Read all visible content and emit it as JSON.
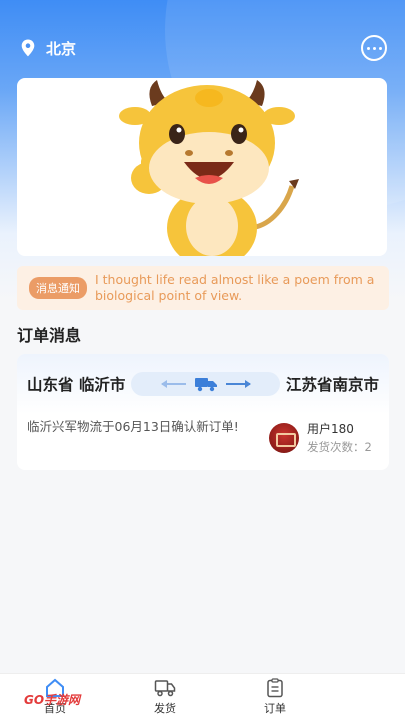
{
  "header": {
    "city": "北京",
    "location_icon": "location-pin-icon",
    "message_icon": "chat-bubble-icon"
  },
  "notice": {
    "tag": "消息通知",
    "text": "I thought life read almost like a poem from a biological point of view."
  },
  "section": {
    "title": "订单消息"
  },
  "order": {
    "from": "山东省 临沂市",
    "to": "江苏省南京市",
    "truck_icon": "truck-icon",
    "message": "临沂兴军物流于06月13日确认新订单!",
    "user_name": "用户180",
    "ship_count": "发货次数：2"
  },
  "tabbar": {
    "items": [
      {
        "label": "首页",
        "icon": "home-icon"
      },
      {
        "label": "发货",
        "icon": "truck-icon"
      },
      {
        "label": "订单",
        "icon": "clipboard-icon"
      }
    ]
  },
  "watermark": {
    "text": "GO手游网"
  },
  "colors": {
    "primary": "#3f8df5",
    "notice_bg": "#fdf0e4",
    "notice_tag": "#eb9c66",
    "notice_text": "#e89a59"
  }
}
